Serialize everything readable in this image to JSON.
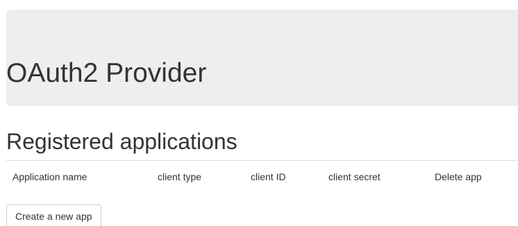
{
  "header": {
    "title": "OAuth2 Provider"
  },
  "applications": {
    "heading": "Registered applications",
    "columns": [
      "Application name",
      "client type",
      "client ID",
      "client secret",
      "Delete app"
    ],
    "rows": []
  },
  "actions": {
    "create_label": "Create a new app"
  }
}
